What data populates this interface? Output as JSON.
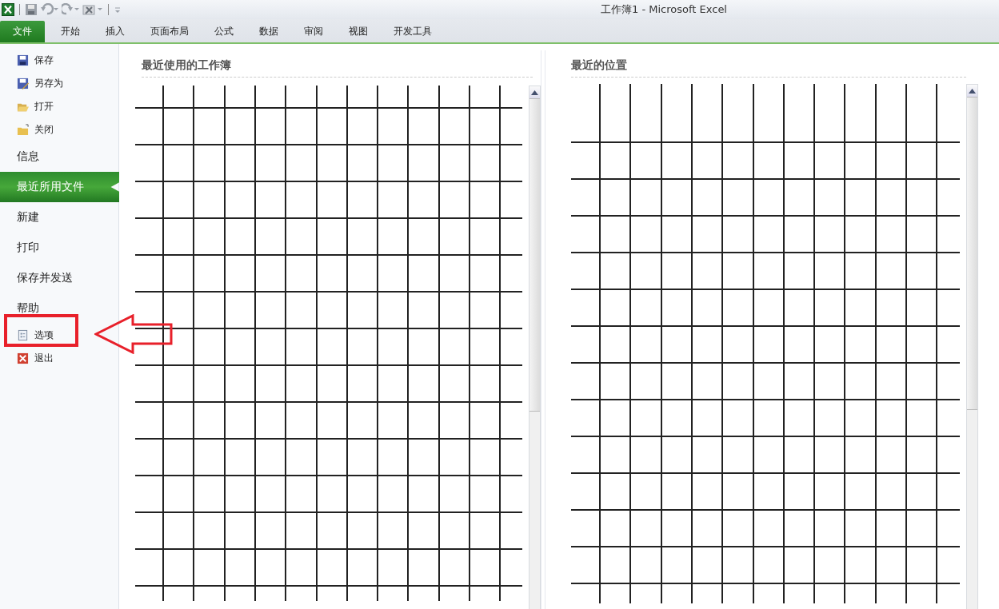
{
  "window": {
    "title": "工作簿1  -  Microsoft Excel"
  },
  "tabs": [
    {
      "label": "文件",
      "selected": true
    },
    {
      "label": "开始",
      "selected": false
    },
    {
      "label": "插入",
      "selected": false
    },
    {
      "label": "页面布局",
      "selected": false
    },
    {
      "label": "公式",
      "selected": false
    },
    {
      "label": "数据",
      "selected": false
    },
    {
      "label": "审阅",
      "selected": false
    },
    {
      "label": "视图",
      "selected": false
    },
    {
      "label": "开发工具",
      "selected": false
    }
  ],
  "sidebar": {
    "items": [
      {
        "label": "保存",
        "kind": "command",
        "selected": false
      },
      {
        "label": "另存为",
        "kind": "command",
        "selected": false
      },
      {
        "label": "打开",
        "kind": "command",
        "selected": false
      },
      {
        "label": "关闭",
        "kind": "command",
        "selected": false
      },
      {
        "label": "信息",
        "kind": "page",
        "selected": false
      },
      {
        "label": "最近所用文件",
        "kind": "page",
        "selected": true
      },
      {
        "label": "新建",
        "kind": "page",
        "selected": false
      },
      {
        "label": "打印",
        "kind": "page",
        "selected": false
      },
      {
        "label": "保存并发送",
        "kind": "page",
        "selected": false
      },
      {
        "label": "帮助",
        "kind": "page",
        "selected": false
      },
      {
        "label": "选项",
        "kind": "command",
        "selected": false
      },
      {
        "label": "退出",
        "kind": "command",
        "selected": false
      }
    ]
  },
  "panels": [
    {
      "title": "最近使用的工作簿"
    },
    {
      "title": "最近的位置"
    }
  ]
}
